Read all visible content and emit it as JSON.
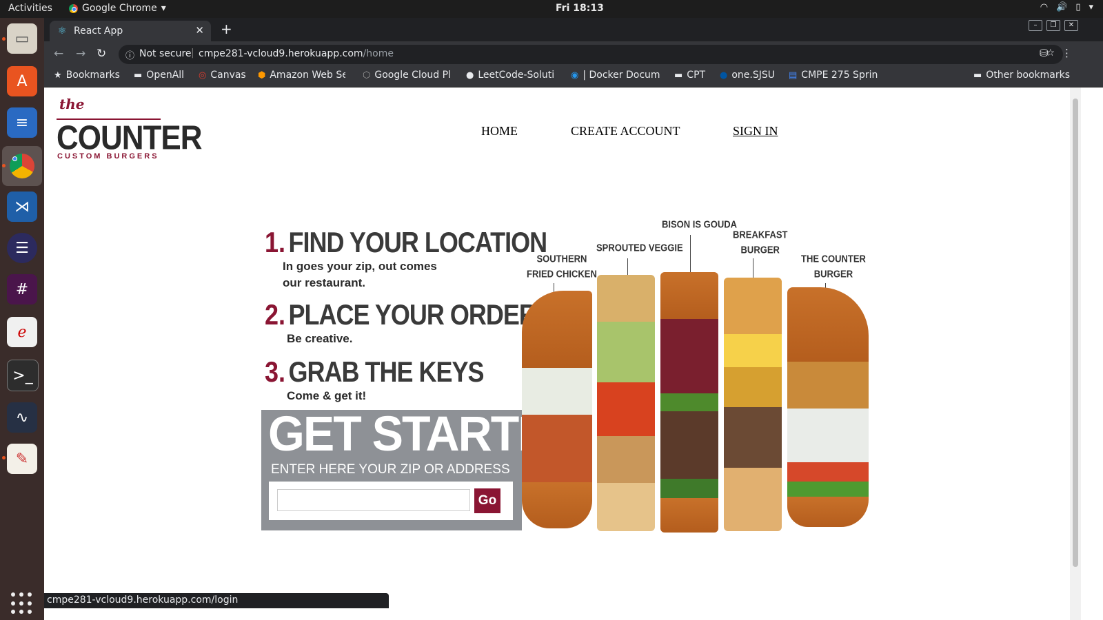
{
  "system": {
    "activities": "Activities",
    "app_name": "Google Chrome",
    "clock": "Fri 18:13"
  },
  "browser": {
    "tab_title": "React App",
    "security_label": "Not secure",
    "url_host": "cmpe281-vcloud9.herokuapp.com",
    "url_path": "/home",
    "status_url": "cmpe281-vcloud9.herokuapp.com/login",
    "bookmarks": [
      {
        "label": "Bookmarks",
        "icon": "star-icon"
      },
      {
        "label": "OpenAll",
        "icon": "folder-icon"
      },
      {
        "label": "Canvas",
        "icon": "canvas-icon"
      },
      {
        "label": "Amazon Web Se",
        "icon": "aws-icon"
      },
      {
        "label": "Google Cloud Pl",
        "icon": "gcp-icon"
      },
      {
        "label": "LeetCode-Soluti",
        "icon": "github-icon"
      },
      {
        "label": "| Docker Docum",
        "icon": "docker-icon"
      },
      {
        "label": "CPT",
        "icon": "folder-icon"
      },
      {
        "label": "one.SJSU",
        "icon": "sjsu-icon"
      },
      {
        "label": "CMPE 275 Spring",
        "icon": "docs-icon"
      }
    ],
    "other_bookmarks": "Other bookmarks"
  },
  "site": {
    "logo": {
      "the": "the",
      "name": "COUNTER",
      "tagline": "CUSTOM BURGERS"
    },
    "nav": {
      "home": "HOME",
      "create_account": "CREATE ACCOUNT",
      "sign_in": "SIGN IN"
    },
    "steps": [
      {
        "num": "1.",
        "title": "FIND YOUR LOCATION",
        "desc_line1": "In goes your zip, out comes",
        "desc_line2": "our restaurant."
      },
      {
        "num": "2.",
        "title": "PLACE YOUR ORDER",
        "desc_line1": "Be creative."
      },
      {
        "num": "3.",
        "title": "GRAB THE KEYS",
        "desc_line1": "Come & get it!"
      }
    ],
    "get_started": {
      "title": "GET STARTED",
      "subtitle": "ENTER HERE YOUR ZIP OR ADDRESS",
      "input_value": "",
      "go_label": "Go"
    },
    "burger_labels": {
      "southern_line1": "SOUTHERN",
      "southern_line2": "FRIED CHICKEN",
      "veggie": "SPROUTED VEGGIE",
      "bison": "BISON IS GOUDA",
      "breakfast_line1": "BREAKFAST",
      "breakfast_line2": "BURGER",
      "counter_line1": "THE COUNTER",
      "counter_line2": "BURGER"
    },
    "brand_colors": {
      "maroon": "#8a1533",
      "gray_panel": "#8e9196"
    }
  }
}
